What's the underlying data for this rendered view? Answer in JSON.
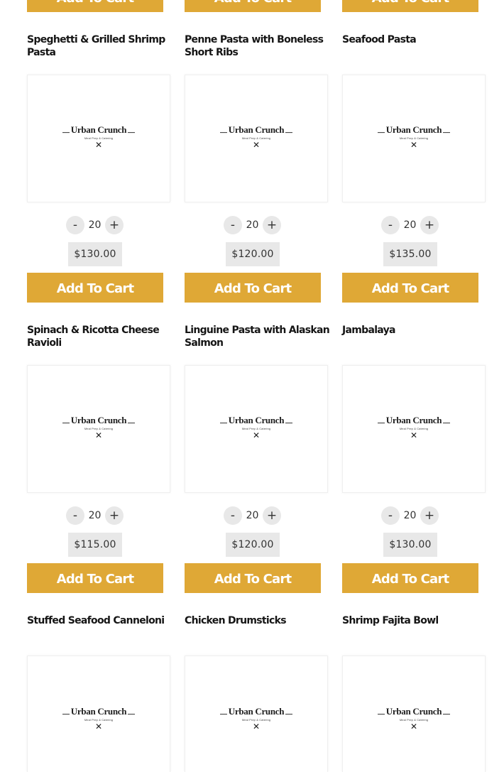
{
  "cart_button_label": "Add To Cart",
  "brand": {
    "logo_word": "Urban Crunch",
    "logo_tagline": "Meal Prep & Catering",
    "icon": "fork-knife-icon"
  },
  "quantity": {
    "minus_label": "-",
    "plus_label": "+"
  },
  "colors": {
    "button_bg": "#dfa836",
    "button_text": "#ffffff",
    "control_bg": "#e8e8e8"
  },
  "products": [
    {
      "title": "Speghetti & Grilled Shrimp Pasta",
      "qty": "20",
      "price": "$130.00"
    },
    {
      "title": "Penne Pasta with Boneless Short Ribs",
      "qty": "20",
      "price": "$120.00"
    },
    {
      "title": "Seafood Pasta",
      "qty": "20",
      "price": "$135.00"
    },
    {
      "title": "Spinach & Ricotta Cheese Ravioli",
      "qty": "20",
      "price": "$115.00"
    },
    {
      "title": "Linguine Pasta with Alaskan Salmon",
      "qty": "20",
      "price": "$120.00"
    },
    {
      "title": "Jambalaya",
      "qty": "20",
      "price": "$130.00"
    },
    {
      "title": "Stuffed Seafood Canneloni"
    },
    {
      "title": "Chicken Drumsticks"
    },
    {
      "title": "Shrimp Fajita Bowl"
    }
  ]
}
